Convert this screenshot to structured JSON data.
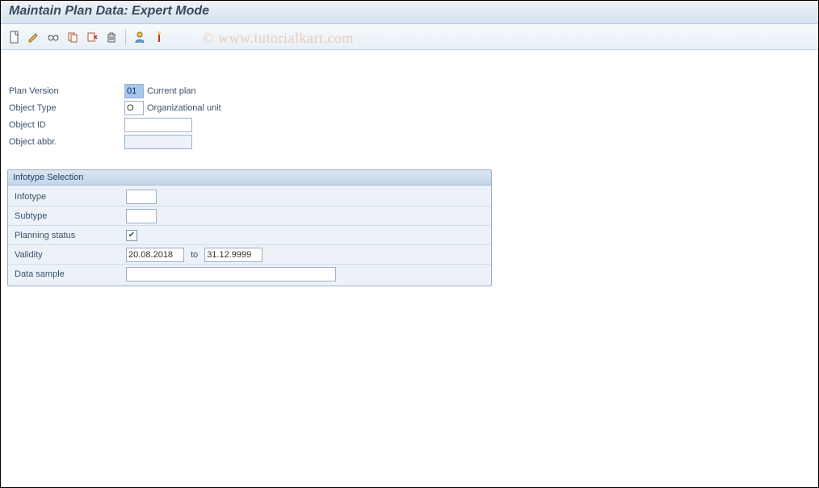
{
  "title": "Maintain Plan Data: Expert Mode",
  "watermark": "© www.tutorialkart.com",
  "toolbar": {
    "icons": [
      "new-doc",
      "edit",
      "glasses",
      "copy",
      "cut",
      "delete",
      "sep",
      "person",
      "wand"
    ]
  },
  "fields": {
    "plan_version_label": "Plan Version",
    "plan_version_value": "01",
    "plan_version_desc": "Current plan",
    "object_type_label": "Object Type",
    "object_type_value": "O",
    "object_type_desc": "Organizational unit",
    "object_id_label": "Object ID",
    "object_id_value": "",
    "object_abbr_label": "Object abbr.",
    "object_abbr_value": ""
  },
  "group": {
    "title": "Infotype Selection",
    "infotype_label": "Infotype",
    "infotype_value": "",
    "subtype_label": "Subtype",
    "subtype_value": "",
    "planning_status_label": "Planning status",
    "planning_status_checked": true,
    "validity_label": "Validity",
    "validity_from": "20.08.2018",
    "validity_to_label": "to",
    "validity_to": "31.12.9999",
    "data_sample_label": "Data sample",
    "data_sample_value": ""
  }
}
